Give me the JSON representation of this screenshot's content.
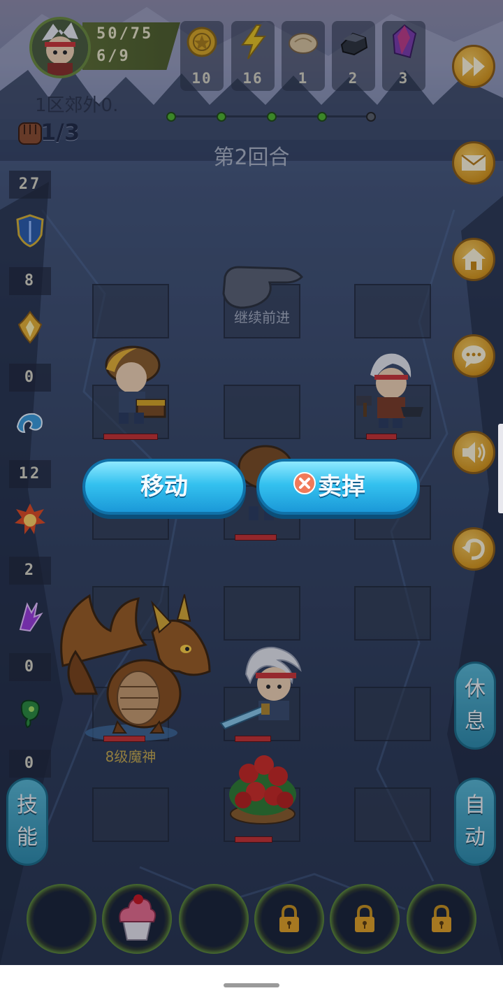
{
  "hud": {
    "hp": "50/75",
    "energy": "6/9",
    "resources": [
      {
        "icon": "gold-coin-icon",
        "count": "10"
      },
      {
        "icon": "lightning-icon",
        "count": "16"
      },
      {
        "icon": "bread-icon",
        "count": "1"
      },
      {
        "icon": "iron-ore-icon",
        "count": "2"
      },
      {
        "icon": "crystal-icon",
        "count": "3"
      }
    ]
  },
  "level": {
    "location": "1区郊外0.",
    "wave": "1/3",
    "round": "第2回合",
    "progress_dots": 5,
    "progress_done": 4
  },
  "stats": [
    {
      "icon": "fist-icon",
      "value": "27"
    },
    {
      "icon": "shield-icon",
      "value": "8"
    },
    {
      "icon": "holy-flame-icon",
      "value": "0"
    },
    {
      "icon": "water-wave-icon",
      "value": "12"
    },
    {
      "icon": "fire-burst-icon",
      "value": "2"
    },
    {
      "icon": "lightning-crystal-icon",
      "value": "0"
    },
    {
      "icon": "poison-icon",
      "value": "0"
    }
  ],
  "board": {
    "hint": "继续前进",
    "enemy_label": "8级魔神"
  },
  "actions": {
    "move": "移动",
    "sell": "卖掉"
  },
  "side_buttons": {
    "rest": "休息",
    "auto": "自动",
    "skill": "技能"
  },
  "menu_buttons": [
    "fast-forward-icon",
    "mail-icon",
    "home-icon",
    "chat-icon",
    "sound-icon",
    "undo-icon"
  ],
  "colors": {
    "gold_button": "#e2a021",
    "blue_button": "#34c1ef",
    "hp_red": "#c8302e",
    "progress_green": "#4fb52a"
  }
}
